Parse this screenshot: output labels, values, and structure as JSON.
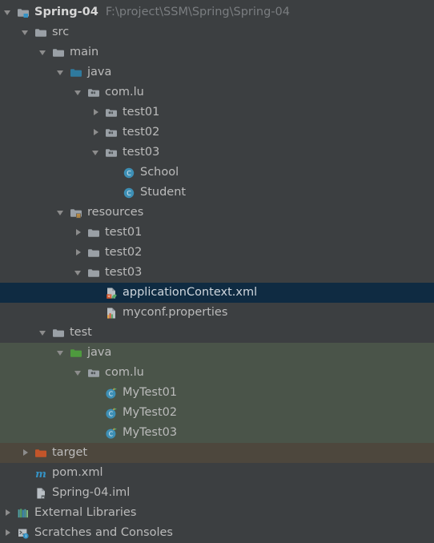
{
  "window": {
    "background_color": "#3c3f41",
    "selection_color": "#0f2b42",
    "test_source_tint": "#4a5449",
    "excluded_tint": "#4d473d",
    "text_color": "#bbbbbb",
    "path_text_color": "#7a7d80"
  },
  "project": {
    "name": "Spring-04",
    "path": "F:\\project\\SSM\\Spring\\Spring-04"
  },
  "tree": {
    "rows": [
      {
        "label": "Spring-04",
        "secondary": "F:\\project\\SSM\\Spring\\Spring-04",
        "depth": 0,
        "twisty": "expanded",
        "icon": "module-folder-icon",
        "bold": true,
        "selected": false,
        "band": "none"
      },
      {
        "label": "src",
        "secondary": "",
        "depth": 1,
        "twisty": "expanded",
        "icon": "folder-icon",
        "bold": false,
        "selected": false,
        "band": "none"
      },
      {
        "label": "main",
        "secondary": "",
        "depth": 2,
        "twisty": "expanded",
        "icon": "folder-icon",
        "bold": false,
        "selected": false,
        "band": "none"
      },
      {
        "label": "java",
        "secondary": "",
        "depth": 3,
        "twisty": "expanded",
        "icon": "source-root-folder-icon",
        "bold": false,
        "selected": false,
        "band": "none"
      },
      {
        "label": "com.lu",
        "secondary": "",
        "depth": 4,
        "twisty": "expanded",
        "icon": "package-icon",
        "bold": false,
        "selected": false,
        "band": "none"
      },
      {
        "label": "test01",
        "secondary": "",
        "depth": 5,
        "twisty": "collapsed",
        "icon": "package-icon",
        "bold": false,
        "selected": false,
        "band": "none"
      },
      {
        "label": "test02",
        "secondary": "",
        "depth": 5,
        "twisty": "collapsed",
        "icon": "package-icon",
        "bold": false,
        "selected": false,
        "band": "none"
      },
      {
        "label": "test03",
        "secondary": "",
        "depth": 5,
        "twisty": "expanded",
        "icon": "package-icon",
        "bold": false,
        "selected": false,
        "band": "none"
      },
      {
        "label": "School",
        "secondary": "",
        "depth": 6,
        "twisty": "none",
        "icon": "java-class-icon",
        "bold": false,
        "selected": false,
        "band": "none"
      },
      {
        "label": "Student",
        "secondary": "",
        "depth": 6,
        "twisty": "none",
        "icon": "java-class-icon",
        "bold": false,
        "selected": false,
        "band": "none"
      },
      {
        "label": "resources",
        "secondary": "",
        "depth": 3,
        "twisty": "expanded",
        "icon": "resource-root-folder-icon",
        "bold": false,
        "selected": false,
        "band": "none"
      },
      {
        "label": "test01",
        "secondary": "",
        "depth": 4,
        "twisty": "collapsed",
        "icon": "folder-icon",
        "bold": false,
        "selected": false,
        "band": "none"
      },
      {
        "label": "test02",
        "secondary": "",
        "depth": 4,
        "twisty": "collapsed",
        "icon": "folder-icon",
        "bold": false,
        "selected": false,
        "band": "none"
      },
      {
        "label": "test03",
        "secondary": "",
        "depth": 4,
        "twisty": "expanded",
        "icon": "folder-icon",
        "bold": false,
        "selected": false,
        "band": "none"
      },
      {
        "label": "applicationContext.xml",
        "secondary": "",
        "depth": 5,
        "twisty": "none",
        "icon": "spring-config-xml-icon",
        "bold": false,
        "selected": true,
        "band": "none"
      },
      {
        "label": "myconf.properties",
        "secondary": "",
        "depth": 5,
        "twisty": "none",
        "icon": "properties-file-icon",
        "bold": false,
        "selected": false,
        "band": "none"
      },
      {
        "label": "test",
        "secondary": "",
        "depth": 2,
        "twisty": "expanded",
        "icon": "folder-icon",
        "bold": false,
        "selected": false,
        "band": "none"
      },
      {
        "label": "java",
        "secondary": "",
        "depth": 3,
        "twisty": "expanded",
        "icon": "test-source-root-folder-icon",
        "bold": false,
        "selected": false,
        "band": "test"
      },
      {
        "label": "com.lu",
        "secondary": "",
        "depth": 4,
        "twisty": "expanded",
        "icon": "package-icon",
        "bold": false,
        "selected": false,
        "band": "test"
      },
      {
        "label": "MyTest01",
        "secondary": "",
        "depth": 5,
        "twisty": "none",
        "icon": "java-test-class-icon",
        "bold": false,
        "selected": false,
        "band": "test"
      },
      {
        "label": "MyTest02",
        "secondary": "",
        "depth": 5,
        "twisty": "none",
        "icon": "java-test-class-icon",
        "bold": false,
        "selected": false,
        "band": "test"
      },
      {
        "label": "MyTest03",
        "secondary": "",
        "depth": 5,
        "twisty": "none",
        "icon": "java-test-class-icon",
        "bold": false,
        "selected": false,
        "band": "test"
      },
      {
        "label": "target",
        "secondary": "",
        "depth": 1,
        "twisty": "collapsed",
        "icon": "excluded-folder-icon",
        "bold": false,
        "selected": false,
        "band": "excluded"
      },
      {
        "label": "pom.xml",
        "secondary": "",
        "depth": 1,
        "twisty": "none",
        "icon": "maven-pom-icon",
        "bold": false,
        "selected": false,
        "band": "none"
      },
      {
        "label": "Spring-04.iml",
        "secondary": "",
        "depth": 1,
        "twisty": "none",
        "icon": "iml-module-file-icon",
        "bold": false,
        "selected": false,
        "band": "none"
      },
      {
        "label": "External Libraries",
        "secondary": "",
        "depth": 0,
        "twisty": "collapsed",
        "icon": "external-libraries-icon",
        "bold": false,
        "selected": false,
        "band": "none"
      },
      {
        "label": "Scratches and Consoles",
        "secondary": "",
        "depth": 0,
        "twisty": "collapsed",
        "icon": "scratches-consoles-icon",
        "bold": false,
        "selected": false,
        "band": "none"
      }
    ]
  }
}
